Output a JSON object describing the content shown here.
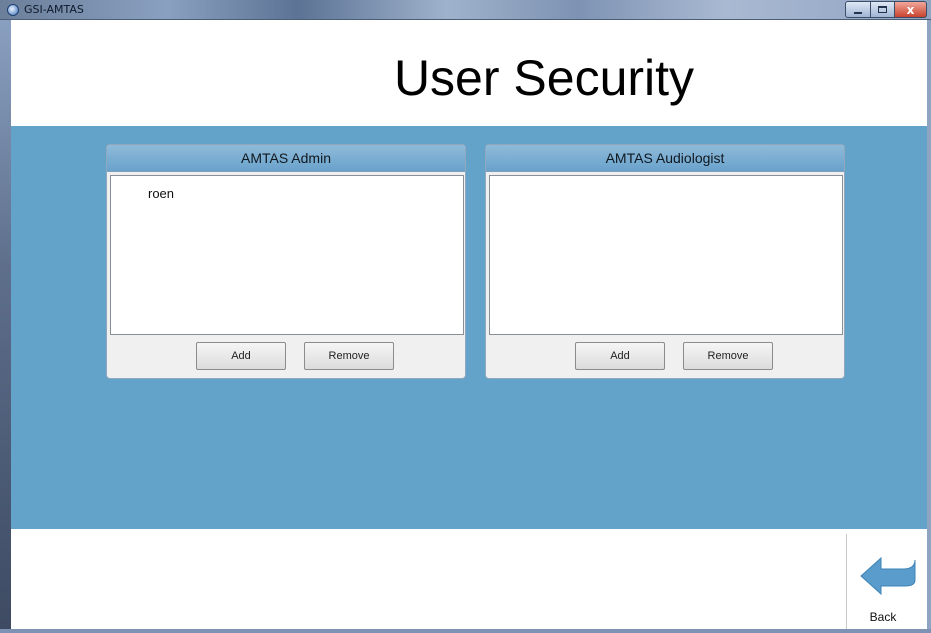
{
  "window": {
    "title": "GSI-AMTAS",
    "close_glyph": "x"
  },
  "page": {
    "title": "User Security"
  },
  "groups": [
    {
      "header": "AMTAS Admin",
      "items": [
        "roen"
      ],
      "add_label": "Add",
      "remove_label": "Remove"
    },
    {
      "header": "AMTAS Audiologist",
      "items": [],
      "add_label": "Add",
      "remove_label": "Remove"
    }
  ],
  "footer": {
    "back_label": "Back",
    "back_icon": "back-arrow-icon"
  },
  "colors": {
    "band": "#63a2c9",
    "group_header": "#6aa2cc",
    "back_arrow": "#5a9dcc"
  }
}
